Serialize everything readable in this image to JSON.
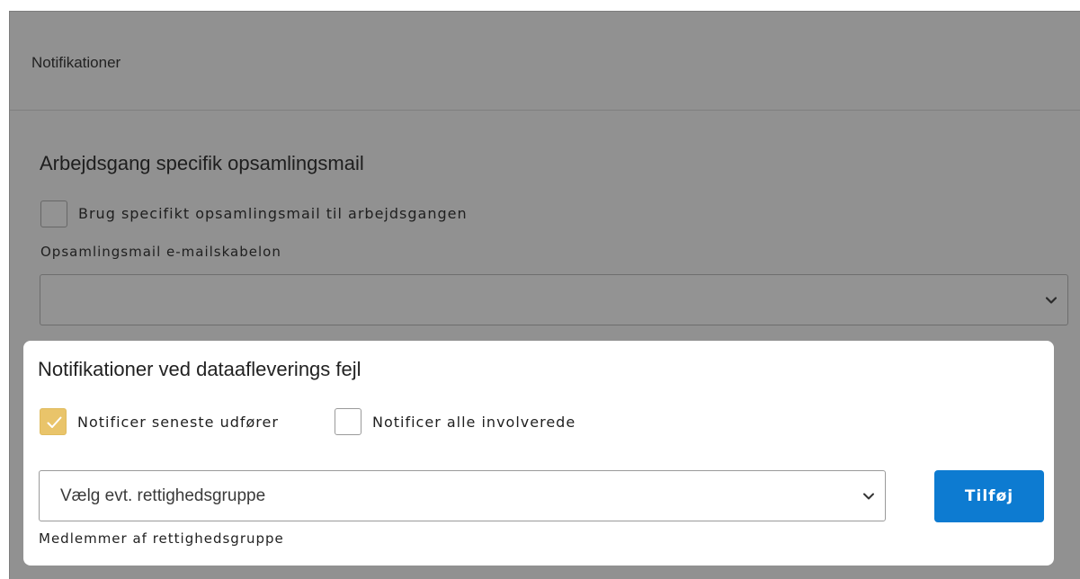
{
  "panel": {
    "title": "Notifikationer"
  },
  "collection_mail": {
    "heading": "Arbejdsgang specifik opsamlingsmail",
    "use_specific_checkbox": {
      "label": "Brug specifikt opsamlingsmail til arbejdsgangen",
      "checked": false
    },
    "template_field": {
      "label": "Opsamlingsmail e-mailskabelon",
      "value": ""
    }
  },
  "delivery_errors": {
    "heading": "Notifikationer ved dataafleverings fejl",
    "notify_latest": {
      "label": "Notificer seneste udfører",
      "checked": true
    },
    "notify_all": {
      "label": "Notificer alle involverede",
      "checked": false
    },
    "group_select": {
      "value": "Vælg evt. rettighedsgruppe"
    },
    "add_button_label": "Tilføj",
    "helper_text": "Medlemmer af rettighedsgruppe"
  },
  "colors": {
    "overlay": "#919191",
    "checkbox_checked": "#e9c46a",
    "primary_button": "#0d7bd1"
  },
  "icons": {
    "checkmark": "check-icon",
    "dropdown": "chevron-down-icon"
  }
}
